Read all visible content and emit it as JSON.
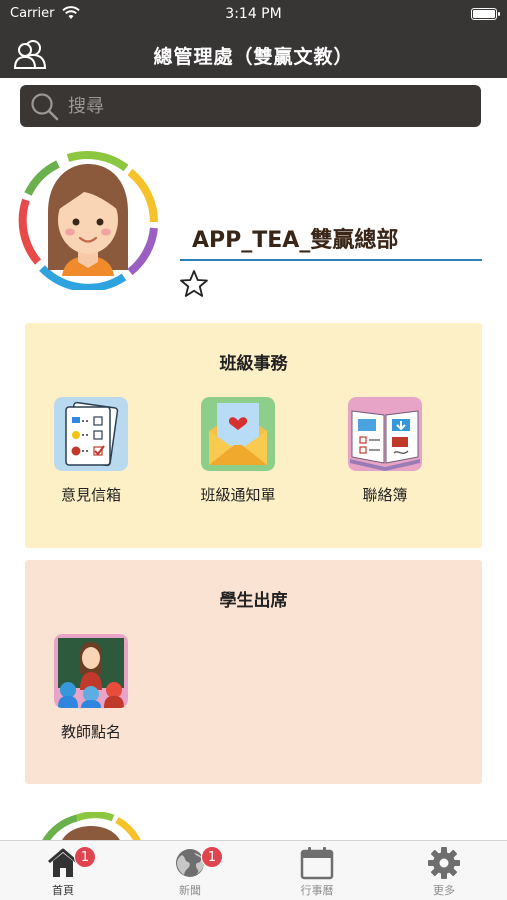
{
  "status_bar": {
    "carrier": "Carrier",
    "time": "3:14 PM"
  },
  "nav": {
    "title": "總管理處（雙贏文教）",
    "left_icon": "users-icon"
  },
  "search": {
    "placeholder": "搜尋"
  },
  "profile": {
    "name": "APP_TEA_雙贏總部",
    "favorite_icon": "star-outline-icon"
  },
  "sections": [
    {
      "title": "班級事務",
      "items": [
        {
          "label": "意見信箱",
          "icon": "survey-clipboard-icon"
        },
        {
          "label": "班級通知單",
          "icon": "envelope-heart-icon"
        },
        {
          "label": "聯絡簿",
          "icon": "open-book-icon"
        }
      ]
    },
    {
      "title": "學生出席",
      "items": [
        {
          "label": "教師點名",
          "icon": "classroom-teacher-icon"
        }
      ]
    }
  ],
  "tabbar": [
    {
      "label": "首頁",
      "icon": "home-icon",
      "badge": "1",
      "active": true
    },
    {
      "label": "新聞",
      "icon": "globe-icon",
      "badge": "1",
      "active": false
    },
    {
      "label": "行事曆",
      "icon": "calendar-icon",
      "badge": "",
      "active": false
    },
    {
      "label": "更多",
      "icon": "gear-icon",
      "badge": "",
      "active": false
    }
  ],
  "colors": {
    "bar_background": "#383535",
    "affairs_card": "#fdf0c6",
    "attendance_card": "#fbe3d3",
    "accent_line": "#2f7fb8",
    "badge": "#e0454f"
  }
}
